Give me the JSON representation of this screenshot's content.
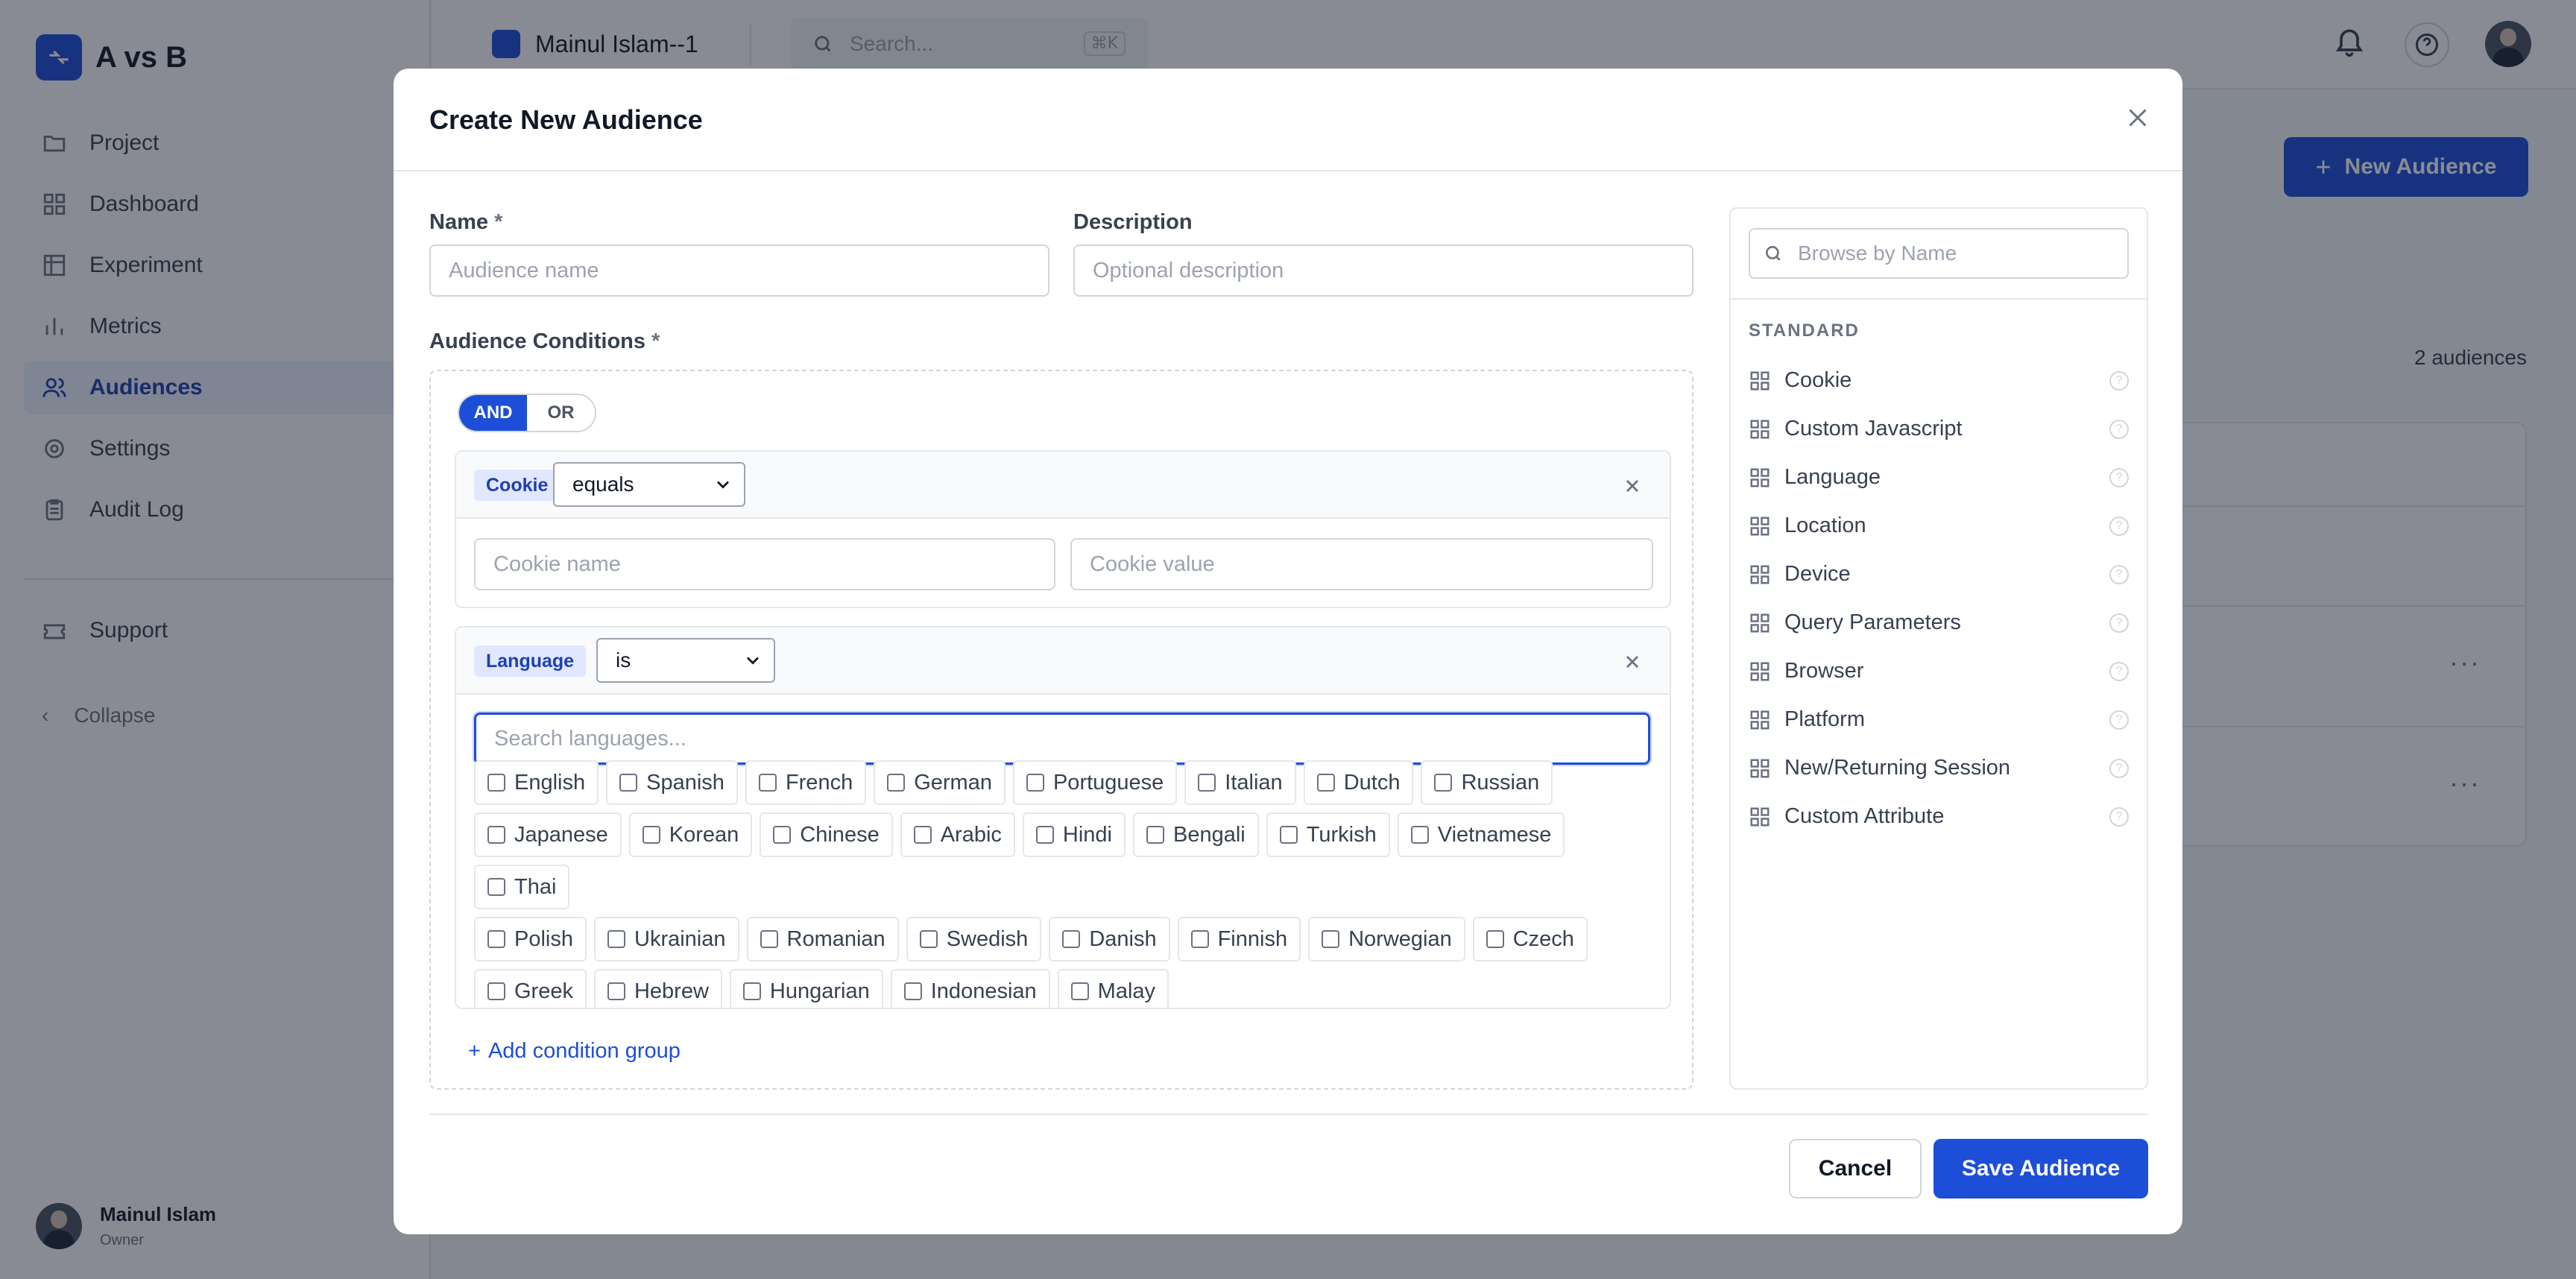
{
  "app": {
    "name": "A vs B"
  },
  "sidebar": {
    "items": [
      {
        "label": "Project",
        "icon": "folder-icon"
      },
      {
        "label": "Dashboard",
        "icon": "grid-icon"
      },
      {
        "label": "Experiment",
        "icon": "table-icon"
      },
      {
        "label": "Metrics",
        "icon": "bar-chart-icon"
      },
      {
        "label": "Audiences",
        "icon": "users-icon",
        "active": true
      },
      {
        "label": "Settings",
        "icon": "gear-icon"
      },
      {
        "label": "Audit Log",
        "icon": "clipboard-icon"
      }
    ],
    "support_label": "Support",
    "collapse_label": "Collapse",
    "user": {
      "name": "Mainul Islam",
      "role": "Owner"
    }
  },
  "topbar": {
    "project_name": "Mainul Islam--1",
    "search_placeholder": "Search...",
    "search_shortcut": "⌘K"
  },
  "page": {
    "new_audience_label": "New Audience",
    "audience_count": "2 audiences"
  },
  "modal": {
    "title": "Create New Audience",
    "name_label": "Name",
    "name_placeholder": "Audience name",
    "description_label": "Description",
    "description_placeholder": "Optional description",
    "conditions_label": "Audience Conditions",
    "required_mark": "*",
    "logic": {
      "and": "AND",
      "or": "OR",
      "selected": "AND"
    },
    "groups": {
      "cookie": {
        "tag": "Cookie",
        "operator": "equals",
        "name_placeholder": "Cookie name",
        "value_placeholder": "Cookie value"
      },
      "language": {
        "tag": "Language",
        "operator": "is",
        "search_placeholder": "Search languages...",
        "options": [
          "English",
          "Spanish",
          "French",
          "German",
          "Portuguese",
          "Italian",
          "Dutch",
          "Russian",
          "Japanese",
          "Korean",
          "Chinese",
          "Arabic",
          "Hindi",
          "Bengali",
          "Turkish",
          "Vietnamese",
          "Thai",
          "Polish",
          "Ukrainian",
          "Romanian",
          "Swedish",
          "Danish",
          "Finnish",
          "Norwegian",
          "Czech",
          "Greek",
          "Hebrew",
          "Hungarian",
          "Indonesian",
          "Malay"
        ]
      }
    },
    "add_group_label": "Add condition group",
    "browse_placeholder": "Browse by Name",
    "standard_heading": "STANDARD",
    "attributes": [
      "Cookie",
      "Custom Javascript",
      "Language",
      "Location",
      "Device",
      "Query Parameters",
      "Browser",
      "Platform",
      "New/Returning Session",
      "Custom Attribute"
    ],
    "cancel_label": "Cancel",
    "save_label": "Save Audience"
  },
  "colors": {
    "accent": "#1d4ed8",
    "overlay": "rgba(17,24,39,0.5)"
  }
}
